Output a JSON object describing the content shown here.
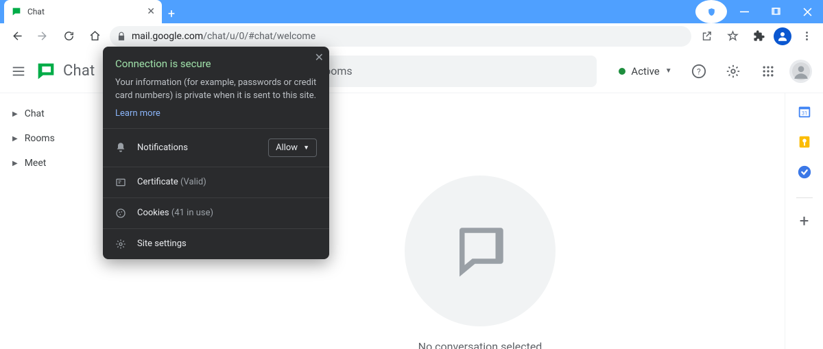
{
  "browser": {
    "tab_title": "Chat",
    "url_host": "mail.google.com",
    "url_path": "/chat/u/0/#chat/welcome"
  },
  "popover": {
    "title": "Connection is secure",
    "description": "Your information (for example, passwords or credit card numbers) is private when it is sent to this site.",
    "learn_more": "Learn more",
    "notifications_label": "Notifications",
    "allow_label": "Allow",
    "certificate_label": "Certificate",
    "certificate_status": "(Valid)",
    "cookies_label": "Cookies",
    "cookies_count": "(41 in use)",
    "site_settings_label": "Site settings"
  },
  "app": {
    "product_name": "Chat",
    "search_placeholder_visible_fragment": "at and rooms",
    "status_label": "Active",
    "empty_state": "No conversation selected"
  },
  "sidebar": {
    "items": [
      {
        "label": "Chat"
      },
      {
        "label": "Rooms"
      },
      {
        "label": "Meet"
      }
    ]
  }
}
